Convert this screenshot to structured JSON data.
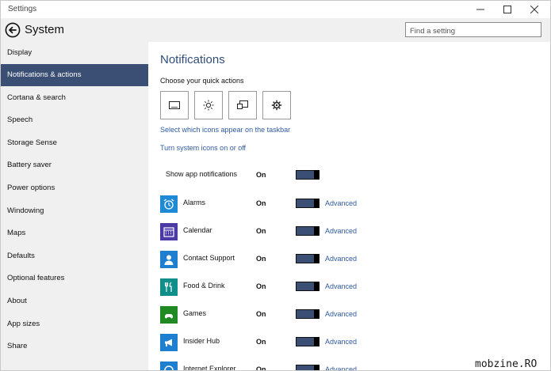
{
  "window": {
    "title": "Settings"
  },
  "header": {
    "title": "System",
    "search_placeholder": "Find a setting"
  },
  "sidebar": {
    "active_index": 1,
    "items": [
      {
        "label": "Display"
      },
      {
        "label": "Notifications & actions"
      },
      {
        "label": "Cortana & search"
      },
      {
        "label": "Speech"
      },
      {
        "label": "Storage Sense"
      },
      {
        "label": "Battery saver"
      },
      {
        "label": "Power options"
      },
      {
        "label": "Windowing"
      },
      {
        "label": "Maps"
      },
      {
        "label": "Defaults"
      },
      {
        "label": "Optional features"
      },
      {
        "label": "About"
      },
      {
        "label": "App sizes"
      },
      {
        "label": "Share"
      }
    ]
  },
  "main": {
    "title": "Notifications",
    "quick_actions_label": "Choose your quick actions",
    "quick_actions": [
      {
        "icon": "tablet-mode-icon"
      },
      {
        "icon": "brightness-icon"
      },
      {
        "icon": "project-icon"
      },
      {
        "icon": "settings-icon"
      }
    ],
    "link_taskbar_icons": "Select which icons appear on the taskbar",
    "link_system_icons": "Turn system icons on or off",
    "show_app_notifications": {
      "label": "Show app notifications",
      "state": "On"
    },
    "advanced_label": "Advanced",
    "apps": [
      {
        "name": "Alarms",
        "state": "On",
        "icon": "alarm-clock-icon",
        "color": "#1e8ad6"
      },
      {
        "name": "Calendar",
        "state": "On",
        "icon": "calendar-icon",
        "color": "#4b3aa6"
      },
      {
        "name": "Contact Support",
        "state": "On",
        "icon": "person-icon",
        "color": "#1e7fd0"
      },
      {
        "name": "Food & Drink",
        "state": "On",
        "icon": "fork-knife-icon",
        "color": "#0f8e8a"
      },
      {
        "name": "Games",
        "state": "On",
        "icon": "xbox-icon",
        "color": "#1f8a24"
      },
      {
        "name": "Insider Hub",
        "state": "On",
        "icon": "megaphone-icon",
        "color": "#1e7fd0"
      },
      {
        "name": "Internet Explorer",
        "state": "On",
        "icon": "ie-icon",
        "color": "#1e7fd0"
      }
    ]
  },
  "colors": {
    "accent": "#3a4f73",
    "link": "#2e5a9e",
    "title": "#2f4e78"
  },
  "watermark": "mobzine.RO"
}
